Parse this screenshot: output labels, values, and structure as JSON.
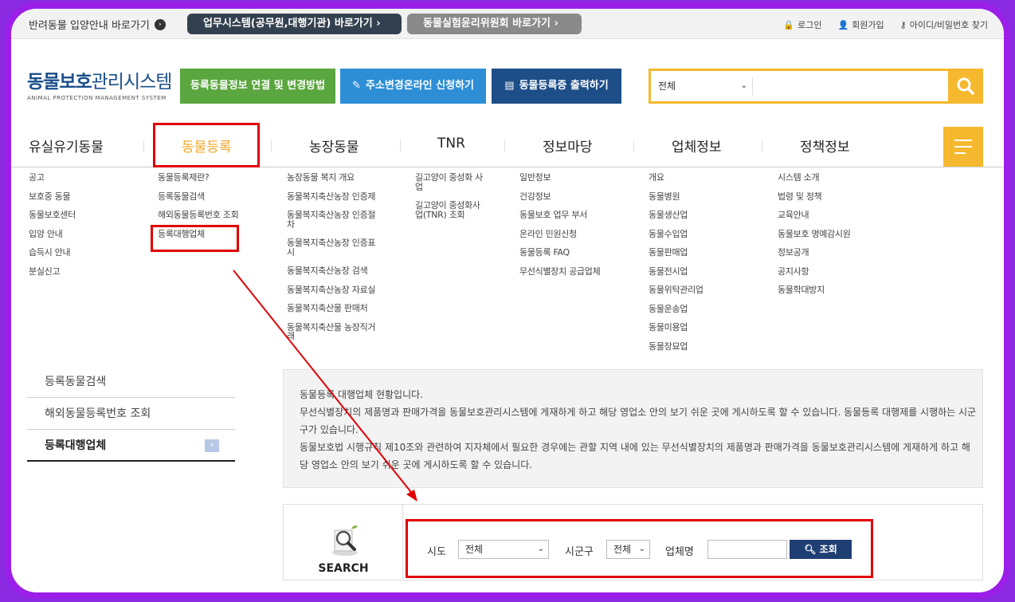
{
  "topbar": {
    "adopt_link": "반려동물 입양안내 바로가기",
    "biz_system": "업무시스템(공무원,대행기관) 바로가기",
    "ethics": "동물실험윤리위원회 바로가기",
    "login": "로그인",
    "signup": "회원가입",
    "find_account": "아이디/비밀번호 찾기"
  },
  "header": {
    "logo_kr_bold": "동물보호",
    "logo_kr_rest": "관리시스템",
    "logo_en": "ANIMAL PROTECTION MANAGEMENT SYSTEM",
    "btn_link": "등록동물정보 연결 및 변경방법",
    "btn_address": "주소변경온라인 신청하기",
    "btn_print": "동물등록증 출력하기",
    "search_scope": "전체"
  },
  "gnb": {
    "items": [
      "유실유기동물",
      "동물등록",
      "농장동물",
      "TNR",
      "정보마당",
      "업체정보",
      "정책정보"
    ]
  },
  "mega": {
    "col1": [
      "공고",
      "보호중 동물",
      "동물보호센터",
      "입양 안내",
      "습득시 안내",
      "분실신고"
    ],
    "col2": [
      "동물등록제란?",
      "등록동물검색",
      "해외동물등록번호 조회",
      "등록대행업체"
    ],
    "col3": [
      "농장동물 복지 개요",
      "동물복지축산농장 인증제",
      "동물복지축산농장 인증절차",
      "동물복지축산농장 인증표시",
      "동물복지축산농장 검색",
      "동물복지축산농장 자료실",
      "동물복지축산물 판매처",
      "동물복지축산물 농장직거래"
    ],
    "col4": [
      "길고양이 중성화 사업",
      "길고양이 중성화사업(TNR) 조회"
    ],
    "col5": [
      "일반정보",
      "건강정보",
      "동물보호 업무 부서",
      "온라인 민원신청",
      "동물등록 FAQ",
      "무선식별장치 공급업체"
    ],
    "col6": [
      "개요",
      "동물병원",
      "동물생산업",
      "동물수입업",
      "동물판매업",
      "동물전시업",
      "동물위탁관리업",
      "동물운송업",
      "동물미용업",
      "동물장묘업"
    ],
    "col7": [
      "시스템 소개",
      "법령 및 정책",
      "교육안내",
      "동물보호 명예감시원",
      "정보공개",
      "공지사항",
      "동물학대방지"
    ]
  },
  "lnb": {
    "items": [
      "등록동물검색",
      "해외동물등록번호 조회",
      "등록대행업체"
    ]
  },
  "info": {
    "l1": "동물등록 대행업체 현황입니다.",
    "l2": "무선식별장치의 제품명과 판매가격을 동물보호관리시스템에 게재하게 하고 해당 영업소 안의 보기 쉬운 곳에 게시하도록 할 수 있습니다. 동물등록 대행제를 시행하는 시군구가 있습니다.",
    "l3": "동물보호법 시행규칙 제10조와 관련하여 지자체에서 필요한 경우에는 관할 지역 내에 있는 무선식별장치의 제품명과 판매가격을 동물보호관리시스템에 게재하게 하고 해당 영업소 안의 보기 쉬운 곳에 게시하도록 할 수 있습니다."
  },
  "search": {
    "label": "SEARCH",
    "sido_label": "시도",
    "sido_value": "전체",
    "sigungu_label": "시군구",
    "sigungu_value": "전체",
    "biz_label": "업체명",
    "go": "조회"
  },
  "colors": {
    "accent": "#f5b82e",
    "annotation": "#e00000",
    "navy": "#1f3f73"
  }
}
